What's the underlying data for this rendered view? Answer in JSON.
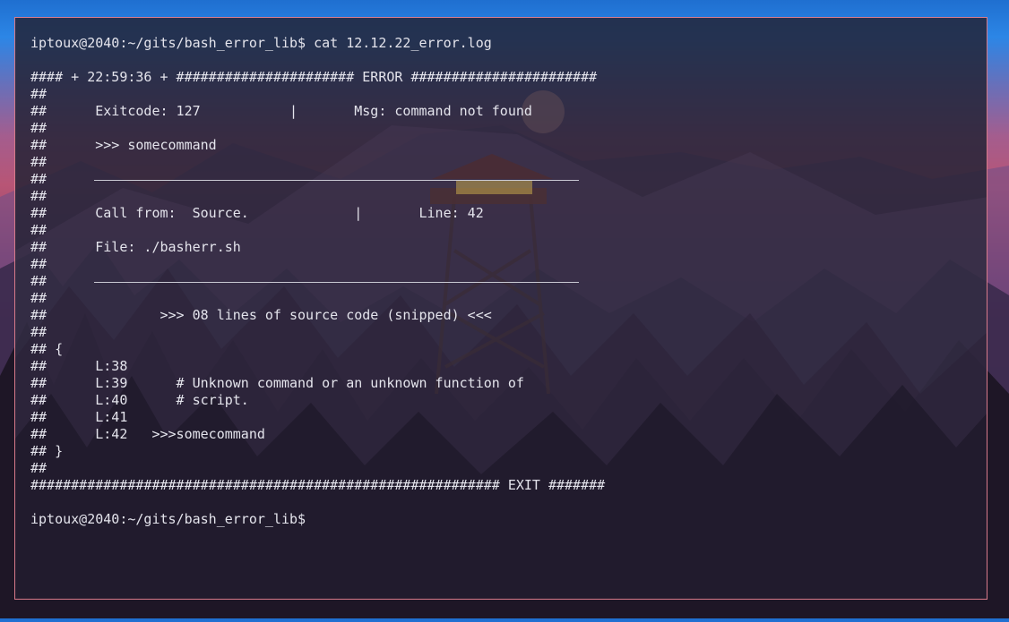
{
  "terminal": {
    "command_line": "iptoux@2040:~/gits/bash_error_lib$ cat 12.12.22_error.log",
    "lines": [
      "#### + 22:59:36 + #####################################################################################################",
      "##",
      "##      Exitcode: 127           |       Msg: command not found",
      "##",
      "##      >>> somecommand",
      "##",
      "##",
      "##",
      "##      Call from:  Source.             |       Line: 42",
      "##",
      "##      File: ./basherr.sh",
      "##",
      "##",
      "##",
      "##              >>> 08 lines of source code (snipped) <<<",
      "##",
      "## {",
      "##      L:38",
      "##      L:39      # Unknown command or an unknown function of",
      "##      L:40      # script.",
      "##      L:41",
      "##      L:42   >>>somecommand",
      "## }",
      "##",
      "########################################################## EXIT #######"
    ],
    "header_line": "#### + 22:59:36 + ###################### ERROR #######################",
    "prompt_line": "iptoux@2040:~/gits/bash_error_lib$"
  }
}
